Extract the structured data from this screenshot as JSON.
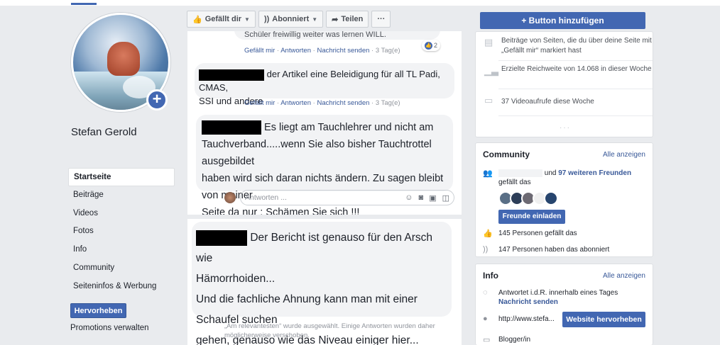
{
  "profile": {
    "name": "Stefan Gerold"
  },
  "nav": {
    "items": [
      {
        "label": "Startseite"
      },
      {
        "label": "Beiträge"
      },
      {
        "label": "Videos"
      },
      {
        "label": "Fotos"
      },
      {
        "label": "Info"
      },
      {
        "label": "Community"
      },
      {
        "label": "Seiteninfos & Werbung"
      }
    ],
    "promote_label": "Hervorheben",
    "promotions_label": "Promotions verwalten"
  },
  "toolbar": {
    "like_label": "Gefällt dir",
    "follow_label": "Abonniert",
    "share_label": "Teilen",
    "more_label": "···",
    "add_button_label": "+ Button hinzufügen"
  },
  "comments": [
    {
      "text_partial": "Schüler freiwillig weiter was lernen WILL.",
      "actions": {
        "like": "Gefällt mir",
        "reply": "Antworten",
        "message": "Nachricht senden",
        "time": "3 Tag(e)"
      },
      "reaction_count": "2"
    },
    {
      "text_first": "der Artikel eine Beleidigung für all TL Padi, CMAS,",
      "text_second": "SSI und andere",
      "actions": {
        "like": "Gefällt mir",
        "reply": "Antworten",
        "message": "Nachricht senden",
        "time": "3 Tag(e)"
      }
    },
    {
      "lines": [
        "Es liegt am Tauchlehrer und nicht am",
        "Tauchverband.....wenn Sie also bisher Tauchtrottel ausgebildet",
        "haben wird sich daran nichts ändern. Zu sagen bleibt von meiner",
        "Seite da nur : Schämen Sie sich !!!"
      ]
    },
    {
      "lines": [
        "Der Bericht ist genauso für den Arsch wie",
        "Hämorrhoiden...",
        "Und die fachliche Ahnung kann man mit einer Schaufel suchen",
        "gehen, genauso wie das Niveau einiger hier..."
      ]
    }
  ],
  "reply": {
    "placeholder": "Antworten ..."
  },
  "feed_note": "„Am relevantesten“ wurde ausgewählt. Einige Antworten wurden daher möglicherweise verschoben.",
  "stats": {
    "page_likes": "Beiträge von Seiten, die du über deine Seite mit „Gefällt mir“ markiert hast",
    "reach": "Erzielte Reichweite von 14.068 in dieser Woche",
    "video_views": "37 Videoaufrufe diese Woche",
    "more_dots": "···"
  },
  "community": {
    "title": "Community",
    "see_all": "Alle anzeigen",
    "friends_prefix": "und ",
    "friends_link": "97 weiteren Freunden",
    "friends_suffix": " gefällt das",
    "invite_label": "Freunde einladen",
    "likes_text": "145 Personen gefällt das",
    "followers_text": "147 Personen haben das abonniert"
  },
  "info": {
    "title": "Info",
    "see_all": "Alle anzeigen",
    "response_text": "Antwortet i.d.R. innerhalb eines Tages",
    "send_message": "Nachricht senden",
    "website": "http://www.stefa...",
    "website_button": "Website hervorheben",
    "category": "Blogger/in"
  },
  "colors": {
    "brand": "#4267b2",
    "link": "#385898",
    "background": "#e9ebee"
  }
}
